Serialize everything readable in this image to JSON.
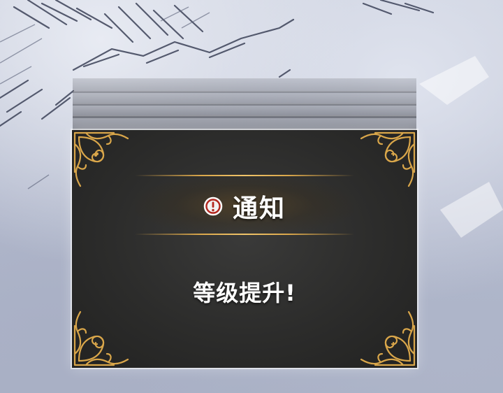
{
  "notification": {
    "title": "通知",
    "message": "等级提升!",
    "icon": "exclamation-circle-icon"
  },
  "colors": {
    "panel": "#2c2c2b",
    "gold": "#d9a64a",
    "alert_red": "#b3261e",
    "text": "#ffffff"
  }
}
